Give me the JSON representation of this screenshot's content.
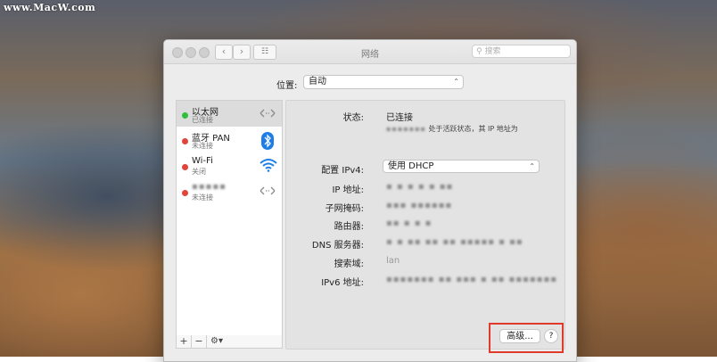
{
  "watermark": "www.MacW.com",
  "window": {
    "title": "网络",
    "search_placeholder": "搜索"
  },
  "location": {
    "label": "位置:",
    "value": "自动"
  },
  "services": [
    {
      "name": "以太网",
      "status": "已连接",
      "dot_color": "#2fbf3a",
      "icon": "ethernet-arrows-icon"
    },
    {
      "name": "蓝牙 PAN",
      "status": "未连接",
      "dot_color": "#e0443a",
      "icon": "bluetooth-icon"
    },
    {
      "name": "Wi-Fi",
      "status": "关闭",
      "dot_color": "#e0443a",
      "icon": "wifi-icon"
    },
    {
      "name": "▪▪▪▪▪",
      "status": "未连接",
      "dot_color": "#e0443a",
      "icon": "network-arrows-icon"
    }
  ],
  "sidebar_buttons": {
    "add": "+",
    "remove": "−",
    "gear": "⚙▾"
  },
  "detail": {
    "status_label": "状态:",
    "status_value": "已连接",
    "status_desc_blurred": "▪▪▪▪▪▪▪",
    "status_desc": "处于活跃状态，其 IP 地址为",
    "config_label": "配置 IPv4:",
    "config_value": "使用 DHCP",
    "ip_label": "IP 地址:",
    "ip_value": "▪ ▪ ▪ ▪ ▪ ▪▪",
    "subnet_label": "子网掩码:",
    "subnet_value": "▪▪▪ ▪▪▪▪▪▪",
    "router_label": "路由器:",
    "router_value": "▪▪ ▪ ▪ ▪",
    "dns_label": "DNS 服务器:",
    "dns_value": "▪ ▪ ▪▪ ▪▪ ▪▪ ▪▪▪▪▪ ▪ ▪▪",
    "search_domain_label": "搜索域:",
    "search_domain_value": "lan",
    "ipv6_label": "IPv6 地址:",
    "ipv6_value": "▪▪▪▪▪▪▪ ▪▪ ▪▪▪ ▪ ▪▪ ▪▪▪▪▪▪▪"
  },
  "advanced_button": "高级...",
  "help_button": "?",
  "highlight_color": "#e03a2a"
}
